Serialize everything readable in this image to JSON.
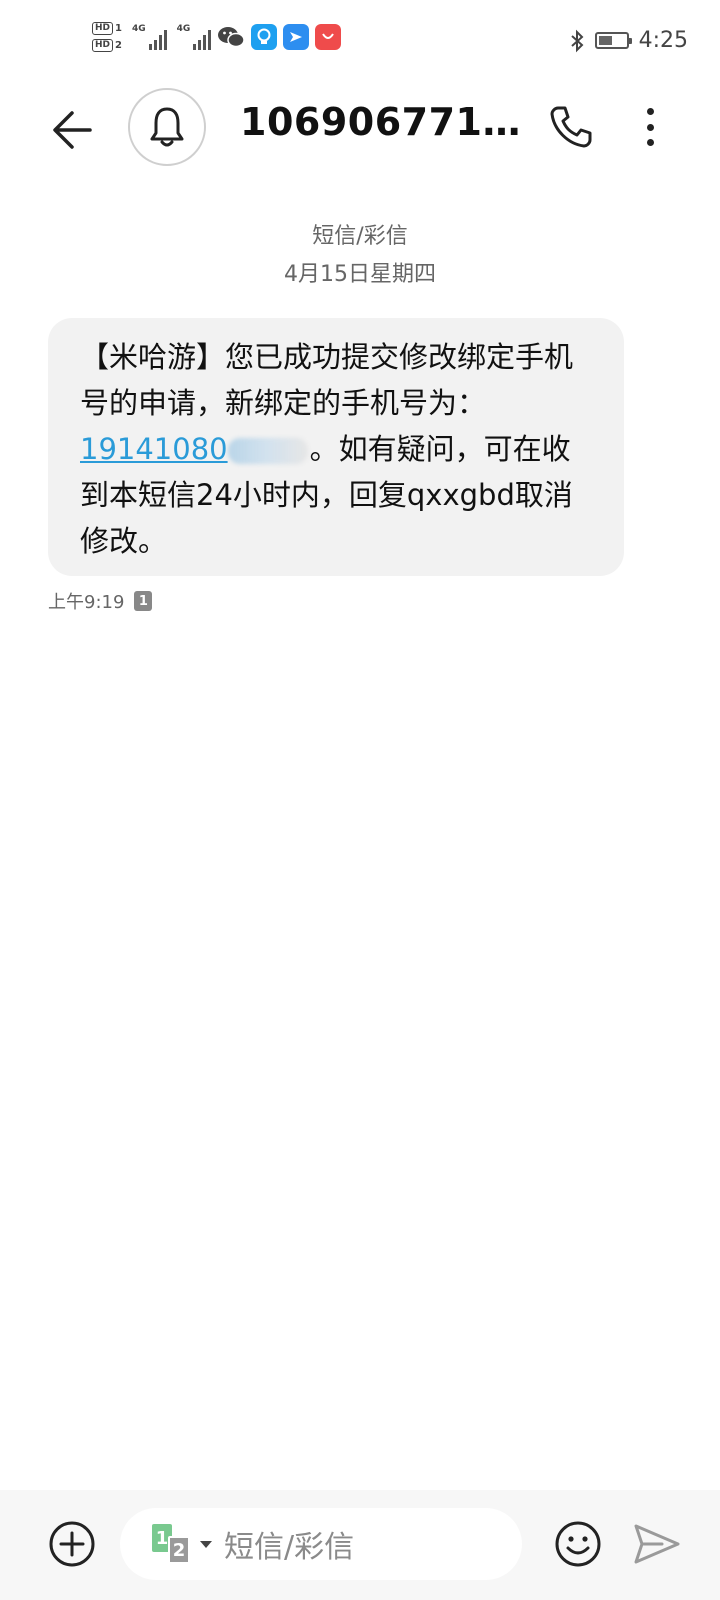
{
  "status_bar": {
    "hd1": "HD",
    "hd1_sim": "1",
    "hd2": "HD",
    "hd2_sim": "2",
    "net1": "4G",
    "net2": "4G",
    "time": "4:25",
    "battery_level": 0.5
  },
  "header": {
    "title": "10690677108..."
  },
  "thread": {
    "type_label": "短信/彩信",
    "date_label": "4月15日星期四"
  },
  "message": {
    "text_before": "【米哈游】您已成功提交修改绑定手机号的申请，新绑定的手机号为：",
    "phone_link": "19141080",
    "text_after": "。如有疑问，可在收到本短信24小时内，回复qxxgbd取消修改。",
    "time": "上午9:19",
    "sim": "1"
  },
  "composer": {
    "placeholder": "短信/彩信",
    "sim1": "1",
    "sim2": "2"
  }
}
